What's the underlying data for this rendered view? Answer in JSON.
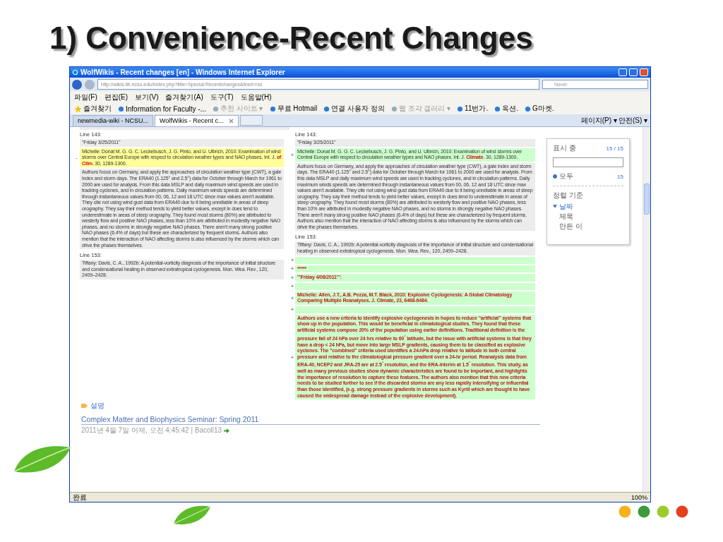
{
  "slide": {
    "title": "1) Convenience-Recent Changes"
  },
  "browser": {
    "title": "WolfWikis - Recent changes [en] - Windows Internet Explorer",
    "address": "http://wikis.lib.ncsu.edu/index.php?title=Special:Recentchanges&feed=rss",
    "search_placeholder": "Naver",
    "menu": [
      "파일(F)",
      "편집(E)",
      "보기(V)",
      "즐겨찾기(A)",
      "도구(T)",
      "도움말(H)"
    ],
    "favorites_label": "즐겨찾기",
    "favorites": [
      {
        "label": "Information for Faculty -...",
        "disabled": false
      },
      {
        "label": "추천 사이트 ▾",
        "disabled": true
      },
      {
        "label": "무료 Hotmail",
        "disabled": false
      },
      {
        "label": "연결 사용자 정의",
        "disabled": false
      },
      {
        "label": "웹 조각 갤러리 ▾",
        "disabled": true
      },
      {
        "label": "11번가.",
        "disabled": false
      },
      {
        "label": "옥션.",
        "disabled": false
      },
      {
        "label": "G마켓.",
        "disabled": false
      }
    ],
    "tabs": [
      {
        "label": "newmedia-wiki - NCSU...",
        "selected": false
      },
      {
        "label": "WolfWikis - Recent c...",
        "selected": true
      }
    ],
    "command_menus": [
      "페이지(P) ▾",
      "안전(S) ▾"
    ],
    "status": "완료",
    "zoom": "100%"
  },
  "diff": {
    "left": [
      {
        "kind": "header",
        "text": "Line 143:"
      },
      {
        "kind": "context",
        "text": "''Friday 3/25/2011''"
      },
      {
        "kind": "deleted",
        "marker": "-",
        "rich": true,
        "text": "Michelle: Donat M. G. G. C. Leckebusch, J. G. Pinto, and U. Ulbrich, 2010: Examination of wind storms over Central Europe with respect to circulation weather types and NAO phases. Int. J. **of Clim.** 30, 1289-1300."
      },
      {
        "kind": "context",
        "text": "Authors focus on Germany, and apply the approaches of circulation weather type (CWT), a gale index and storm days. The ERA40 (1.125° and 2.5°) data for October through March for 1961 to 2000 are used for analysis. From this data MSLP and daily maximum wind speeds are used in tracking cyclones, and in circulation patterns. Daily maximum winds speeds are determined through instantaneous values from 00, 06, 12 and 18 UTC since max values aren't available. They cite not using wind gust data from ERA40 due to it being unreliable in areas of steep orography. They say their method tends to yield better values, except in does tend to underestimate in areas of steep orography. They found most storms (80%) are attributed to westerly flow and positive NAO phases, less than 10% are attributed in modestly negative NAO phases, and no storms in strongly negative NAO phases. There aren't many strong positive NAO phases (6.4% of days) but these are characterized by frequent storms. Authors also mention that the interaction of NAO affecting storms is also influenced by the storms which can drive the phases themselves."
      },
      {
        "kind": "header",
        "text": "Line 153:"
      },
      {
        "kind": "context",
        "text": "Tiffany: Davis, C. A., 1992b: A potential-vorticity diagnosis of the importance of initial structure and condensational heating in observed extratropical cyclogenesis. Mon. Wea. Rev., 120, 2409–2428."
      }
    ],
    "right": [
      {
        "kind": "header",
        "text": "Line 143:"
      },
      {
        "kind": "context",
        "text": "''Friday 3/25/2011''"
      },
      {
        "kind": "added",
        "marker": "+",
        "rich": true,
        "text": "Michelle: Donat M. G. G. C. Leckebusch, J. G. Pinto, and U. Ulbrich, 2010: Examination of wind storms over Central Europe with respect to circulation weather types and NAO phases. Int. J. **Climate**. 30, 1289-1300."
      },
      {
        "kind": "context",
        "text": "Authors focus on Germany, and apply the approaches of circulation weather type (CWT), a gale index and storm days. The ERA40 (1.125° and 2.5°) data for October through March for 1961 to 2000 are used for analysis. From this data MSLP and daily maximum wind speeds are used in tracking cyclones, and in circulation patterns. Daily maximum winds speeds are determined through instantaneous values from 00, 06, 12 and 18 UTC since max values aren't available. They cite not using wind gust data from ERA40 due to it being unreliable in areas of steep orography. They say their method tends to yield better values, except in does tend to underestimate in areas of steep orography. They found most storms (80%) are attributed to westerly flow and positive NAO phases, less than 10% are attributed in modestly negative NAO phases, and no storms in strongly negative NAO phases. There aren't many strong positive NAO phases (6.4% of days) but these are characterized by frequent storms. Authors also mention that the interaction of NAO affecting storms is also influenced by the storms which can drive the phases themselves."
      },
      {
        "kind": "header",
        "text": "Line 153:"
      },
      {
        "kind": "context",
        "text": "Tiffany: Davis, C. A., 1992b: A potential-vorticity diagnosis of the importance of initial structure and condensational heating in observed extratropical cyclogenesis. Mon. Wea. Rev., 120, 2409–2428."
      },
      {
        "kind": "inserted",
        "marker": "+"
      },
      {
        "kind": "inserted",
        "marker": "+",
        "text": "*****"
      },
      {
        "kind": "inserted",
        "marker": "+",
        "text": "'''Friday 4/08/2011''':"
      },
      {
        "kind": "inserted",
        "marker": "+"
      },
      {
        "kind": "inserted",
        "marker": "+",
        "text": "Michelle: Allen, J.T., A.B. Pezza, M.T. Black, 2010: Explosive Cyclogenesis: A Global Climatology Comparing Multiple Reanalyses. J. Climate, 23, 6468-6484."
      },
      {
        "kind": "inserted",
        "marker": "+"
      },
      {
        "kind": "inserted",
        "marker": "+",
        "rich": true,
        "text": "Authors use a new criteria to identify explosive cyclogenesis in hopes to reduce \"artificial\" systems that show up in the population. This would be beneficial in climatological studies. They found that these artificial systems compose 20% of the population using earlier definitions. Traditional definition is the pressure fall of 24 hPa over 24 hrs relative to 60$^{°}$ latitude, but the issue with artificial systems is that they have a drop < 24 hPa, but move into large MSLP gradients, causing them to be classified as explosive cyclones. The \"combined\" criteria used identifies a 24-hPa drop relative to latitude in both central pressure and relative to the climatological pressure gradient over a 24-hr period. Reanalysis data from ERA-40, NCEP2 and JRA-25 are at 2.5$^{°}$ resolution, and the ERA-Interim at 1.5$^{°}$ resolution. This study, as well as many previous studies show dynamic characteristics are found to be important, and highlights the importance of resolution to capture these features. The authors also mention that this new criteria needs to be studied further to see if the discarded storms are any less rapidly intensifying or influential than those identified, (e.g. strong pressure gradients in storms such as Kyrill which are thought to have caused the widespread damage instead of the explosive development)."
      }
    ]
  },
  "side_panel": {
    "showing_label": "표시 중",
    "showing_count": "15 / 15",
    "filters": [
      {
        "label": "모두",
        "count": "15",
        "selected": true
      }
    ],
    "sort_label": "정렬 기준",
    "sort_options": [
      {
        "label": "날짜",
        "selected": true
      },
      {
        "label": "제목",
        "selected": false
      },
      {
        "label": "만든 이",
        "selected": false
      }
    ]
  },
  "footer": {
    "link": "설명",
    "entry_title": "Complex Matter and Biophysics Seminar: Spring 2011",
    "entry_meta": "2011년 4월 7일 어제, 오전 4:45:42 | Bacoll13"
  }
}
